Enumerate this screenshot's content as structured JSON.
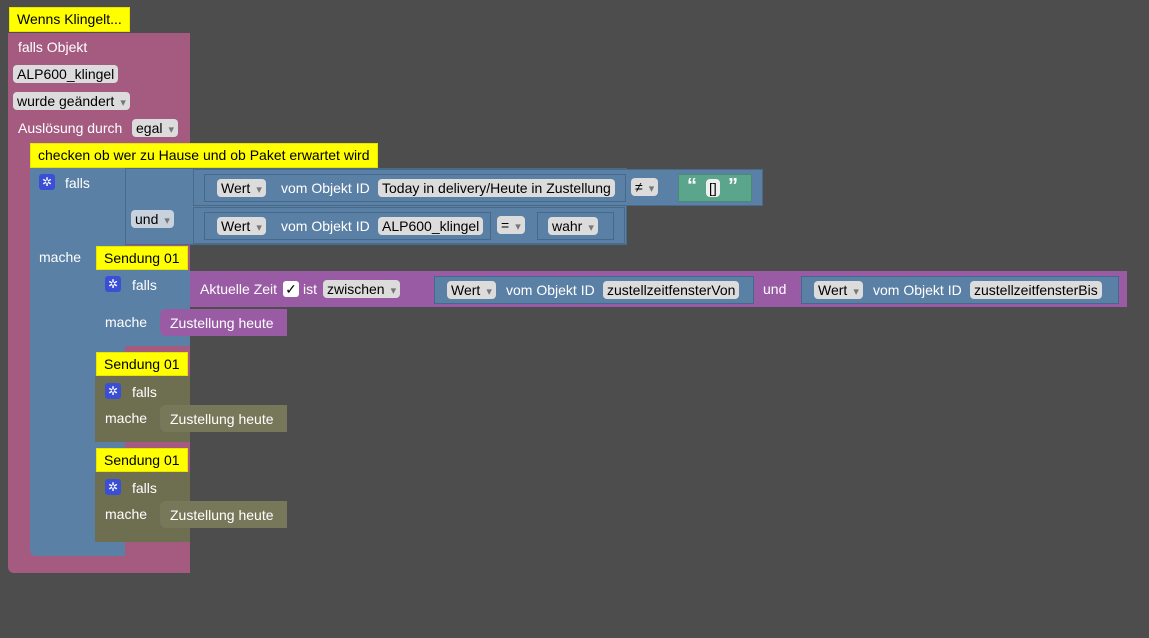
{
  "trigger": {
    "comment": "Wenns Klingelt...",
    "header": "falls Objekt",
    "object_id": "ALP600_klingel",
    "change_mode": "wurde geändert",
    "trigger_by_label": "Auslösung durch",
    "trigger_by_value": "egal"
  },
  "main_if": {
    "comment": "checken ob wer zu Hause und ob Paket erwartet wird",
    "if_label": "falls",
    "do_label": "mache",
    "and_label": "und",
    "cond1": {
      "value_label": "Wert",
      "of_object_label": "vom Objekt ID",
      "object_id": "Today in delivery/Heute in Zustellung",
      "operator": "≠",
      "string_open": "“",
      "string_value": "[]",
      "string_close": "”"
    },
    "cond2": {
      "value_label": "Wert",
      "of_object_label": "vom Objekt ID",
      "object_id": "ALP600_klingel",
      "operator": "=",
      "bool_value": "wahr"
    }
  },
  "shipments": [
    {
      "comment": "Sendung 01",
      "if_label": "falls",
      "do_label": "mache",
      "action": "Zustellung heute",
      "time_cond": {
        "label": "Aktuelle Zeit",
        "check": "✓",
        "is_label": "ist",
        "mode": "zwischen",
        "from_value_label": "Wert",
        "from_of_object": "vom Objekt ID",
        "from_object_id": "zustellzeitfensterVon",
        "and_label": "und",
        "to_value_label": "Wert",
        "to_of_object": "vom Objekt ID",
        "to_object_id": "zustellzeitfensterBis"
      }
    },
    {
      "comment": "Sendung 01",
      "if_label": "falls",
      "do_label": "mache",
      "action": "Zustellung heute"
    },
    {
      "comment": "Sendung 01",
      "if_label": "falls",
      "do_label": "mache",
      "action": "Zustellung heute"
    }
  ],
  "icons": {
    "gear": "gear-icon",
    "dropdown": "chevron-down-icon"
  }
}
